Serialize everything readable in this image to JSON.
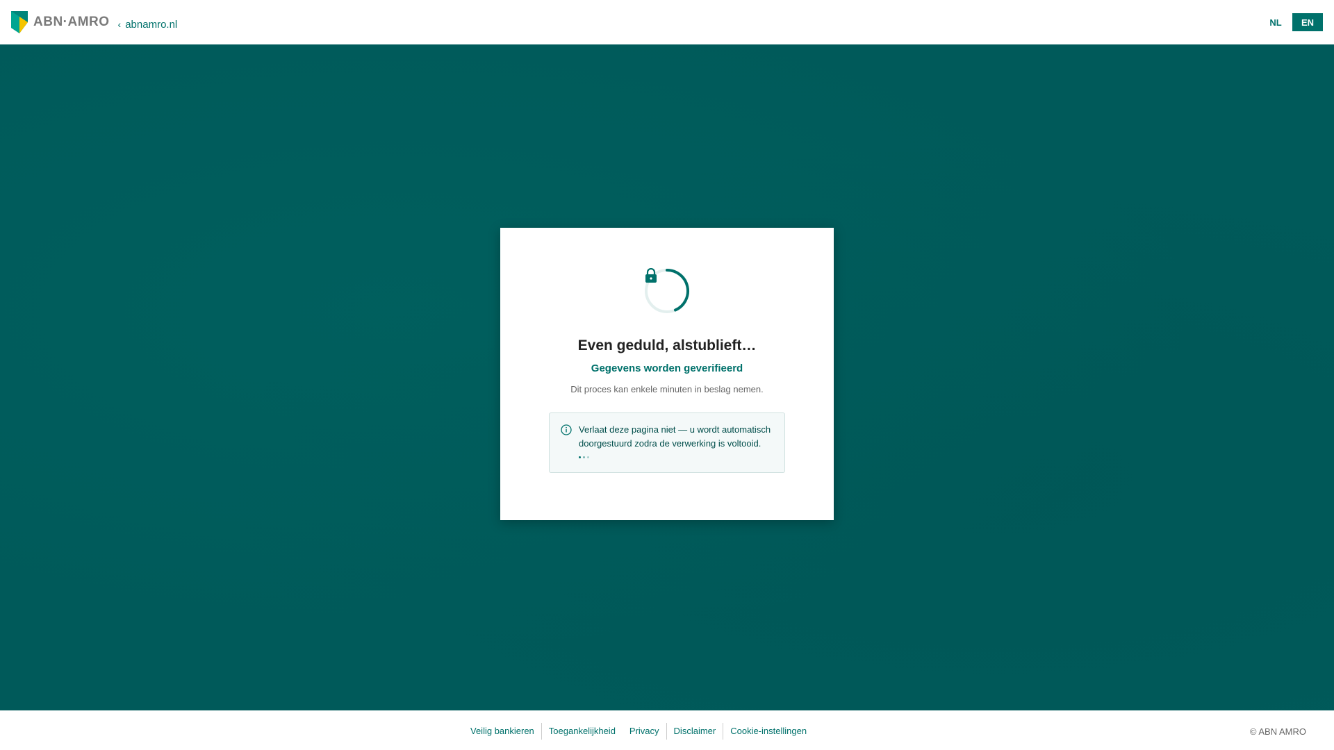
{
  "header": {
    "logo_text": "ABN·AMRO",
    "back_link": "abnamro.nl",
    "lang_nl": "NL",
    "lang_en": "EN"
  },
  "card": {
    "title": "Even geduld, alstublieft…",
    "subtitle": "Gegevens worden geverifieerd",
    "description": "Dit proces kan enkele minuten in beslag nemen.",
    "notice": "Verlaat deze pagina niet — u wordt automatisch doorgestuurd zodra de verwerking is voltooid."
  },
  "footer": {
    "links": [
      "Veilig bankieren",
      "Toegankelijkheid",
      "Privacy",
      "Disclaimer",
      "Cookie-instellingen"
    ],
    "copyright": "© ABN AMRO"
  },
  "colors": {
    "brand": "#00716b",
    "background": "#005a5a",
    "logo_yellow": "#f5c400",
    "logo_teal": "#00857a"
  },
  "icons": {
    "logo": "abn-amro-shield-icon",
    "back": "chevron-left-icon",
    "spinner": "spinner-icon",
    "lock": "lock-icon",
    "info": "info-icon"
  }
}
